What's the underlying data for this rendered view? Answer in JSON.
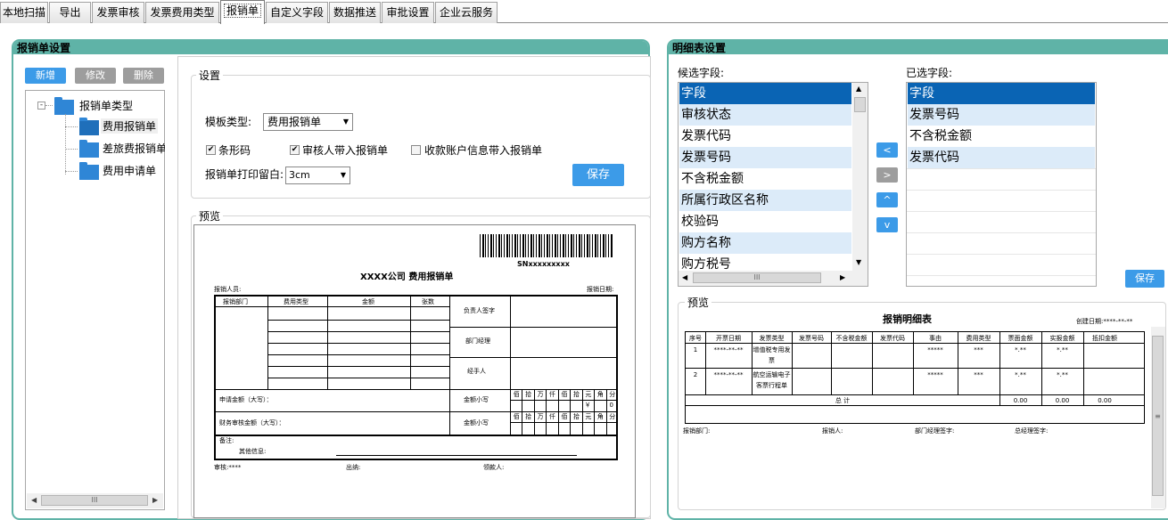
{
  "tabs": [
    "本地扫描",
    "导出",
    "发票审核",
    "发票费用类型",
    "报销单",
    "自定义字段",
    "数据推送",
    "审批设置",
    "企业云服务"
  ],
  "left_panel": {
    "title": "报销单设置",
    "buttons": {
      "add": "新增",
      "edit": "修改",
      "delete": "删除"
    },
    "tree": {
      "root": "报销单类型",
      "items": [
        "费用报销单",
        "差旅费报销单",
        "费用申请单"
      ]
    },
    "settings": {
      "legend": "设置",
      "template_label": "模板类型:",
      "template_value": "费用报销单",
      "barcode": "条形码",
      "reviewer": "审核人带入报销单",
      "account_info": "收款账户信息带入报销单",
      "margin_label": "报销单打印留白:",
      "margin_value": "3cm",
      "save": "保存"
    },
    "preview": {
      "legend": "预览",
      "sn": "SNxxxxxxxxx",
      "title": "XXXX公司   费用报销单",
      "reporter": "报销人员:",
      "report_date": "报销日期:",
      "cols": [
        "报销部门",
        "费用类型",
        "金额",
        "张数"
      ],
      "right_labels": [
        "负责人签字",
        "部门经理",
        "经手人"
      ],
      "apply_amount": "申请金额（大写）：",
      "finance_amount": "财务审核金额（大写）：",
      "subtotal": "金额小写",
      "digit_units": [
        "佰",
        "拾",
        "万",
        "仟",
        "佰",
        "拾",
        "元",
        "角",
        "分"
      ],
      "yen": "￥",
      "zero": "0",
      "remark": "备注:",
      "other": "其他信息:",
      "audit": "审核:****",
      "cashier": "出纳:",
      "receiver": "领款人:"
    }
  },
  "right_panel": {
    "title": "明细表设置",
    "candidate_label": "候选字段:",
    "selected_label": "已选字段:",
    "candidates": [
      "字段",
      "审核状态",
      "发票代码",
      "发票号码",
      "不含税金额",
      "所属行政区名称",
      "校验码",
      "购方名称",
      "购方税号"
    ],
    "selected": [
      "字段",
      "发票号码",
      "不含税金额",
      "发票代码"
    ],
    "arrows": [
      "<",
      ">",
      "^",
      "v"
    ],
    "save": "保存",
    "preview": {
      "legend": "预览",
      "title": "报销明细表",
      "created": "创建日期:****-**-**",
      "headers": [
        "序号",
        "开票日期",
        "发票类型",
        "发票号码",
        "不含税金额",
        "发票代码",
        "事由",
        "费用类型",
        "票面金额",
        "实报金额",
        "抵扣金额"
      ],
      "rows": [
        [
          "1",
          "****-**-**",
          "增值税专用发票",
          "",
          "",
          "",
          "*****",
          "***",
          "*.**",
          "*.**",
          ""
        ],
        [
          "2",
          "****-**-**",
          "航空运输电子客票行程单",
          "",
          "",
          "",
          "*****",
          "***",
          "*.**",
          "*.**",
          ""
        ]
      ],
      "total_label": "总        计",
      "totals": [
        "0.00",
        "0.00",
        "0.00"
      ],
      "footer": [
        "报销部门:",
        "报销人:",
        "部门经理签字:",
        "总经理签字:"
      ]
    }
  },
  "colors": {
    "accent": "#3c9be8",
    "panel": "#5fb3a7",
    "grey_btn": "#9d9d9d",
    "selected": "#0a64b4",
    "stripe": "#dcebf9"
  }
}
